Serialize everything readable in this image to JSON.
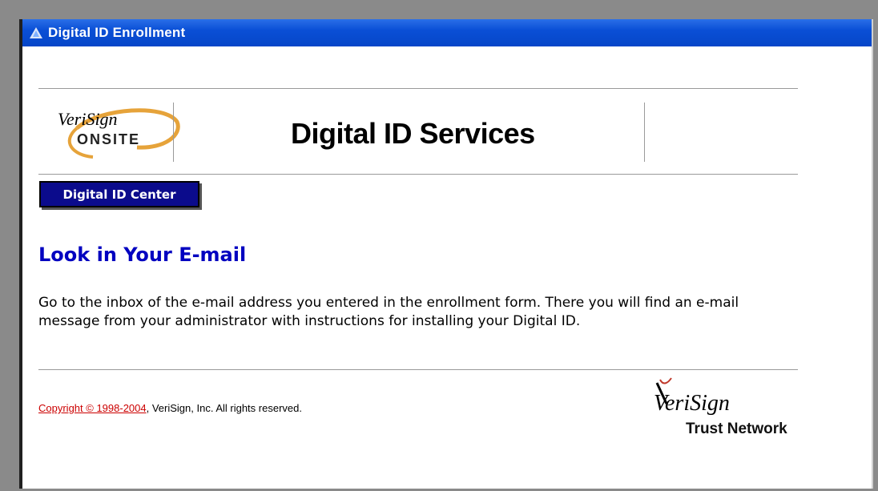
{
  "window": {
    "title": "Digital ID Enrollment"
  },
  "header": {
    "logo_brand": "VeriSign",
    "logo_product": "ONSITE",
    "services_title": "Digital ID Services"
  },
  "nav": {
    "center_button_label": "Digital ID Center"
  },
  "main": {
    "heading": "Look in Your E-mail",
    "body": "Go to the inbox of the e-mail address you entered in the enrollment form. There you will find an e-mail message from your administrator with instructions for installing your Digital ID."
  },
  "footer": {
    "copyright_link": "Copyright © 1998-2004",
    "copyright_rest": ", VeriSign, Inc. All rights reserved.",
    "logo_brand": "VeriSign",
    "logo_tagline": "Trust Network"
  },
  "colors": {
    "titlebar": "#0a4fd6",
    "heading": "#0000c0",
    "button_bg": "#0b0b8c",
    "link": "#cc0000"
  }
}
